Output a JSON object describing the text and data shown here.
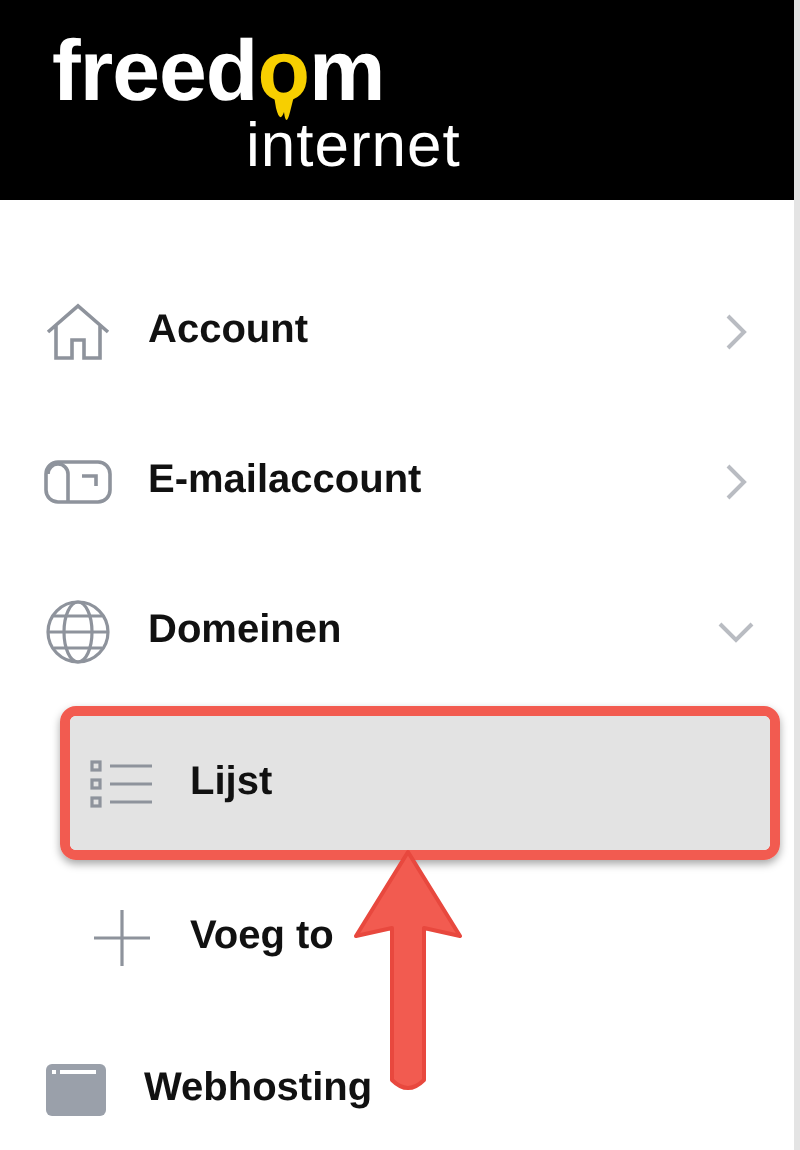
{
  "logo": {
    "word": "freedom",
    "subtitle": "internet"
  },
  "menu": [
    {
      "label": "Account",
      "expanded": false
    },
    {
      "label": "E-mailaccount",
      "expanded": false
    },
    {
      "label": "Domeinen",
      "expanded": true,
      "children": [
        {
          "label": "Lijst",
          "selected": true
        },
        {
          "label": "Voeg to",
          "selected": false
        }
      ]
    },
    {
      "label": "Webhosting"
    }
  ]
}
